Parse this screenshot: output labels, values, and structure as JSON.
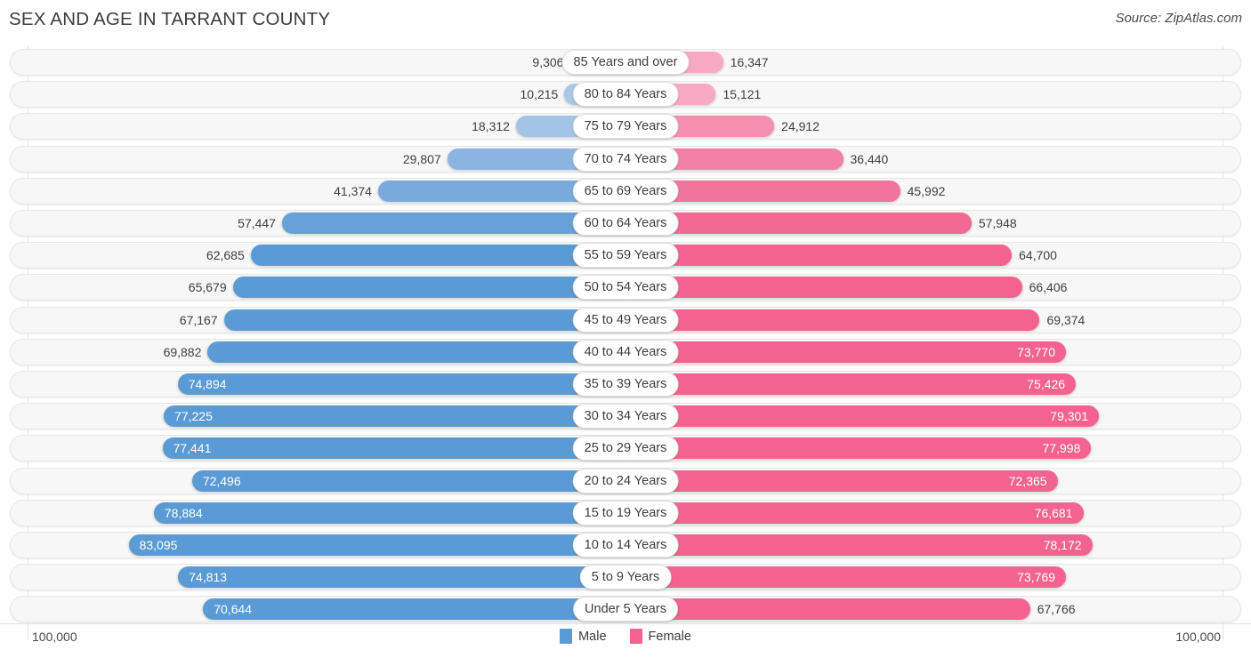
{
  "header": {
    "title": "SEX AND AGE IN TARRANT COUNTY",
    "source": "Source: ZipAtlas.com"
  },
  "axis": {
    "left_label": "100,000",
    "right_label": "100,000"
  },
  "legend": {
    "male_label": "Male",
    "female_label": "Female",
    "male_color": "#5b9bd5",
    "female_color": "#f4638f"
  },
  "chart_data": {
    "type": "bar",
    "title": "SEX AND AGE IN TARRANT COUNTY",
    "subtitle": "Source: ZipAtlas.com",
    "xlabel": "",
    "ylabel": "",
    "orientation": "horizontal-diverging",
    "axis_max": 100000,
    "xlim": [
      -100000,
      100000
    ],
    "grid": false,
    "legend_position": "bottom-center",
    "categories": [
      "85 Years and over",
      "80 to 84 Years",
      "75 to 79 Years",
      "70 to 74 Years",
      "65 to 69 Years",
      "60 to 64 Years",
      "55 to 59 Years",
      "50 to 54 Years",
      "45 to 49 Years",
      "40 to 44 Years",
      "35 to 39 Years",
      "30 to 34 Years",
      "25 to 29 Years",
      "20 to 24 Years",
      "15 to 19 Years",
      "10 to 14 Years",
      "5 to 9 Years",
      "Under 5 Years"
    ],
    "series": [
      {
        "name": "Male",
        "color": "#5b9bd5",
        "values": [
          9306,
          10215,
          18312,
          29807,
          41374,
          57447,
          62685,
          65679,
          67167,
          69882,
          74894,
          77225,
          77441,
          72496,
          78884,
          83095,
          74813,
          70644
        ],
        "labels": [
          "9,306",
          "10,215",
          "18,312",
          "29,807",
          "41,374",
          "57,447",
          "62,685",
          "65,679",
          "67,167",
          "69,882",
          "74,894",
          "77,225",
          "77,441",
          "72,496",
          "78,884",
          "83,095",
          "74,813",
          "70,644"
        ]
      },
      {
        "name": "Female",
        "color": "#f4638f",
        "values": [
          16347,
          15121,
          24912,
          36440,
          45992,
          57948,
          64700,
          66406,
          69374,
          73770,
          75426,
          79301,
          77998,
          72365,
          76681,
          78172,
          73769,
          67766
        ],
        "labels": [
          "16,347",
          "15,121",
          "24,912",
          "36,440",
          "45,992",
          "57,948",
          "64,700",
          "66,406",
          "69,374",
          "73,770",
          "75,426",
          "79,301",
          "77,998",
          "72,365",
          "76,681",
          "78,172",
          "73,769",
          "67,766"
        ]
      }
    ]
  }
}
